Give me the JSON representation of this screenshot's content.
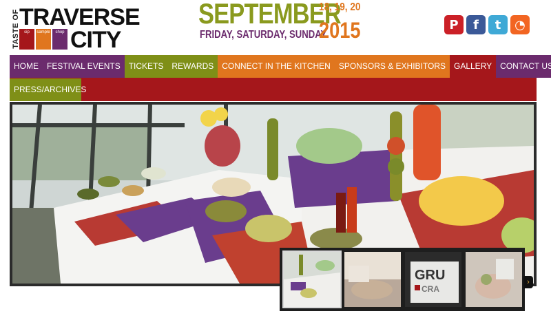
{
  "logo": {
    "taste_of": "TASTE OF",
    "traverse": "TRAVERSE",
    "city": "CITY",
    "icon_labels": [
      "sip",
      "sample",
      "shop"
    ],
    "icon_colors": [
      "#a5171b",
      "#e0761e",
      "#6b2b6d"
    ]
  },
  "event_date": {
    "month": "SEPTEMBER",
    "days": "18, 19, 20",
    "weekdays": "FRIDAY, SATURDAY, SUNDAY",
    "year": "2015"
  },
  "social": [
    {
      "name": "pinterest",
      "glyph": "P",
      "color": "#cb2027"
    },
    {
      "name": "facebook",
      "glyph": "f",
      "color": "#3b5998"
    },
    {
      "name": "twitter",
      "glyph": "t",
      "color": "#3fa9d6"
    },
    {
      "name": "rss",
      "glyph": "◔",
      "color": "#f26522"
    }
  ],
  "nav": {
    "row1": [
      {
        "label": "HOME",
        "color": "#6b2b6d"
      },
      {
        "label": "FESTIVAL EVENTS",
        "color": "#6b2b6d"
      },
      {
        "label": "TICKETS",
        "color": "#7f8f17"
      },
      {
        "label": "REWARDS",
        "color": "#7f8f17"
      },
      {
        "label": "CONNECT IN THE KITCHEN",
        "color": "#e0761e"
      },
      {
        "label": "SPONSORS & EXHIBITORS",
        "color": "#e0761e"
      },
      {
        "label": "GALLERY",
        "color": "#a5171b"
      },
      {
        "label": "CONTACT US",
        "color": "#6b2b6d"
      }
    ],
    "row2": [
      {
        "label": "PRESS/ARCHIVES",
        "color": "#7f8f17"
      }
    ]
  },
  "slideshow": {
    "thumbnail_count": 4,
    "selected_thumbnail": 1,
    "next_glyph": "›"
  }
}
